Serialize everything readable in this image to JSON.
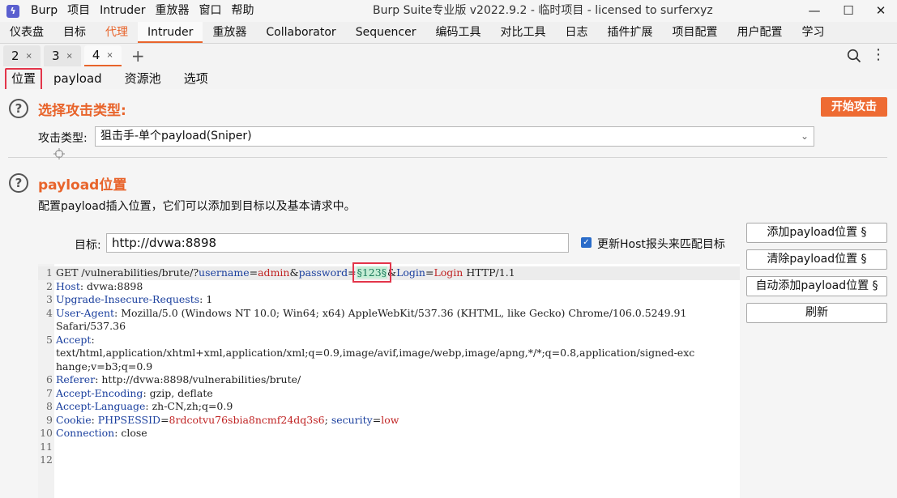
{
  "app": {
    "menu": [
      "Burp",
      "项目",
      "Intruder",
      "重放器",
      "窗口",
      "帮助"
    ],
    "window_title": "Burp Suite专业版  v2022.9.2 - 临时项目 - licensed to surferxyz",
    "minimize": "—",
    "maximize": "☐",
    "close": "✕"
  },
  "main_tabs": [
    "仪表盘",
    "目标",
    "代理",
    "Intruder",
    "重放器",
    "Collaborator",
    "Sequencer",
    "编码工具",
    "对比工具",
    "日志",
    "插件扩展",
    "项目配置",
    "用户配置",
    "学习"
  ],
  "attack_tabs": [
    {
      "label": "2"
    },
    {
      "label": "3"
    },
    {
      "label": "4"
    }
  ],
  "attack_tab_close": "×",
  "new_tab": "+",
  "intruder_tabs": [
    "位置",
    "payload",
    "资源池",
    "选项"
  ],
  "attack_type_section": {
    "help": "?",
    "title": "选择攻击类型:",
    "start_button": "开始攻击",
    "label": "攻击类型:",
    "selected": "狙击手-单个payload(Sniper)",
    "chevron": "⌄"
  },
  "payload_positions_section": {
    "help": "?",
    "title": "payload位置",
    "description": "配置payload插入位置，它们可以添加到目标以及基本请求中。",
    "target_label": "目标:",
    "target_value": "http://dvwa:8898",
    "update_host_checkbox": {
      "label": "更新Host报头来匹配目标",
      "checked": true,
      "mark": "✓"
    }
  },
  "side_buttons": {
    "add": "添加payload位置 §",
    "clear": "清除payload位置 §",
    "auto": "自动添加payload位置 §",
    "refresh": "刷新"
  },
  "request": {
    "line_numbers": [
      "1",
      "2",
      "3",
      "4",
      "5",
      "6",
      "7",
      "8",
      "9",
      "10",
      "11",
      "12"
    ],
    "l1": {
      "a": "GET /vulnerabilities/brute/?",
      "p1": "username",
      "eq": "=",
      "v1": "admin",
      "amp": "&",
      "p2": "password",
      "eq2": "=",
      "payload": "§123§",
      "amp2": "&",
      "p3": "Login",
      "eq3": "=",
      "v3": "Login",
      "tail": " HTTP/1.1"
    },
    "l2": {
      "k": "Host",
      "v": ": dvwa:8898"
    },
    "l3": {
      "k": "Upgrade-Insecure-Requests",
      "v": ": 1"
    },
    "l4": {
      "k": "User-Agent",
      "v": ": Mozilla/5.0 (Windows NT 10.0; Win64; x64) AppleWebKit/537.36 (KHTML, like Gecko) Chrome/106.0.5249.91",
      "cont": "Safari/537.36"
    },
    "l5": {
      "k": "Accept",
      "v": ":",
      "cont1": "text/html,application/xhtml+xml,application/xml;q=0.9,image/avif,image/webp,image/apng,*/*;q=0.8,application/signed-exc",
      "cont2": "hange;v=b3;q=0.9"
    },
    "l6": {
      "k": "Referer",
      "v": ": http://dvwa:8898/vulnerabilities/brute/"
    },
    "l7": {
      "k": "Accept-Encoding",
      "v": ": gzip, deflate"
    },
    "l8": {
      "k": "Accept-Language",
      "v": ": zh-CN,zh;q=0.9"
    },
    "l9": {
      "k": "Cookie",
      "c1k": "PHPSESSID",
      "c1v": "8rdcotvu76sbia8ncmf24dq3s6",
      "sep": "; ",
      "c2k": "security",
      "c2v": "low",
      "colon": ": ",
      "eq": "="
    },
    "l10": {
      "k": "Connection",
      "v": ": close"
    }
  }
}
